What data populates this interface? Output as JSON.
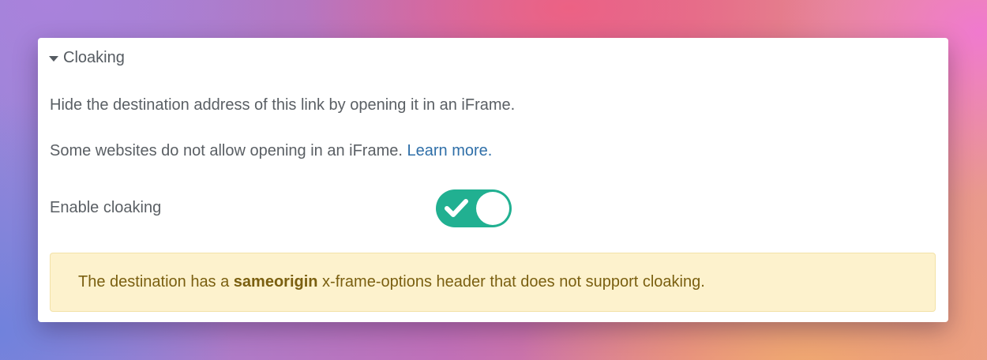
{
  "section": {
    "title": "Cloaking",
    "expanded": true
  },
  "description": {
    "line1": "Hide the destination address of this link by opening it in an iFrame.",
    "line2_prefix": "Some websites do not allow opening in an iFrame. ",
    "learn_more": "Learn more."
  },
  "toggle": {
    "label": "Enable cloaking",
    "enabled": true,
    "on_color": "#21b091"
  },
  "alert": {
    "prefix": "The destination has a ",
    "bold": "sameorigin",
    "suffix": " x-frame-options header that does not support cloaking."
  },
  "icons": {
    "caret": "caret-down-icon",
    "check": "check-icon"
  }
}
